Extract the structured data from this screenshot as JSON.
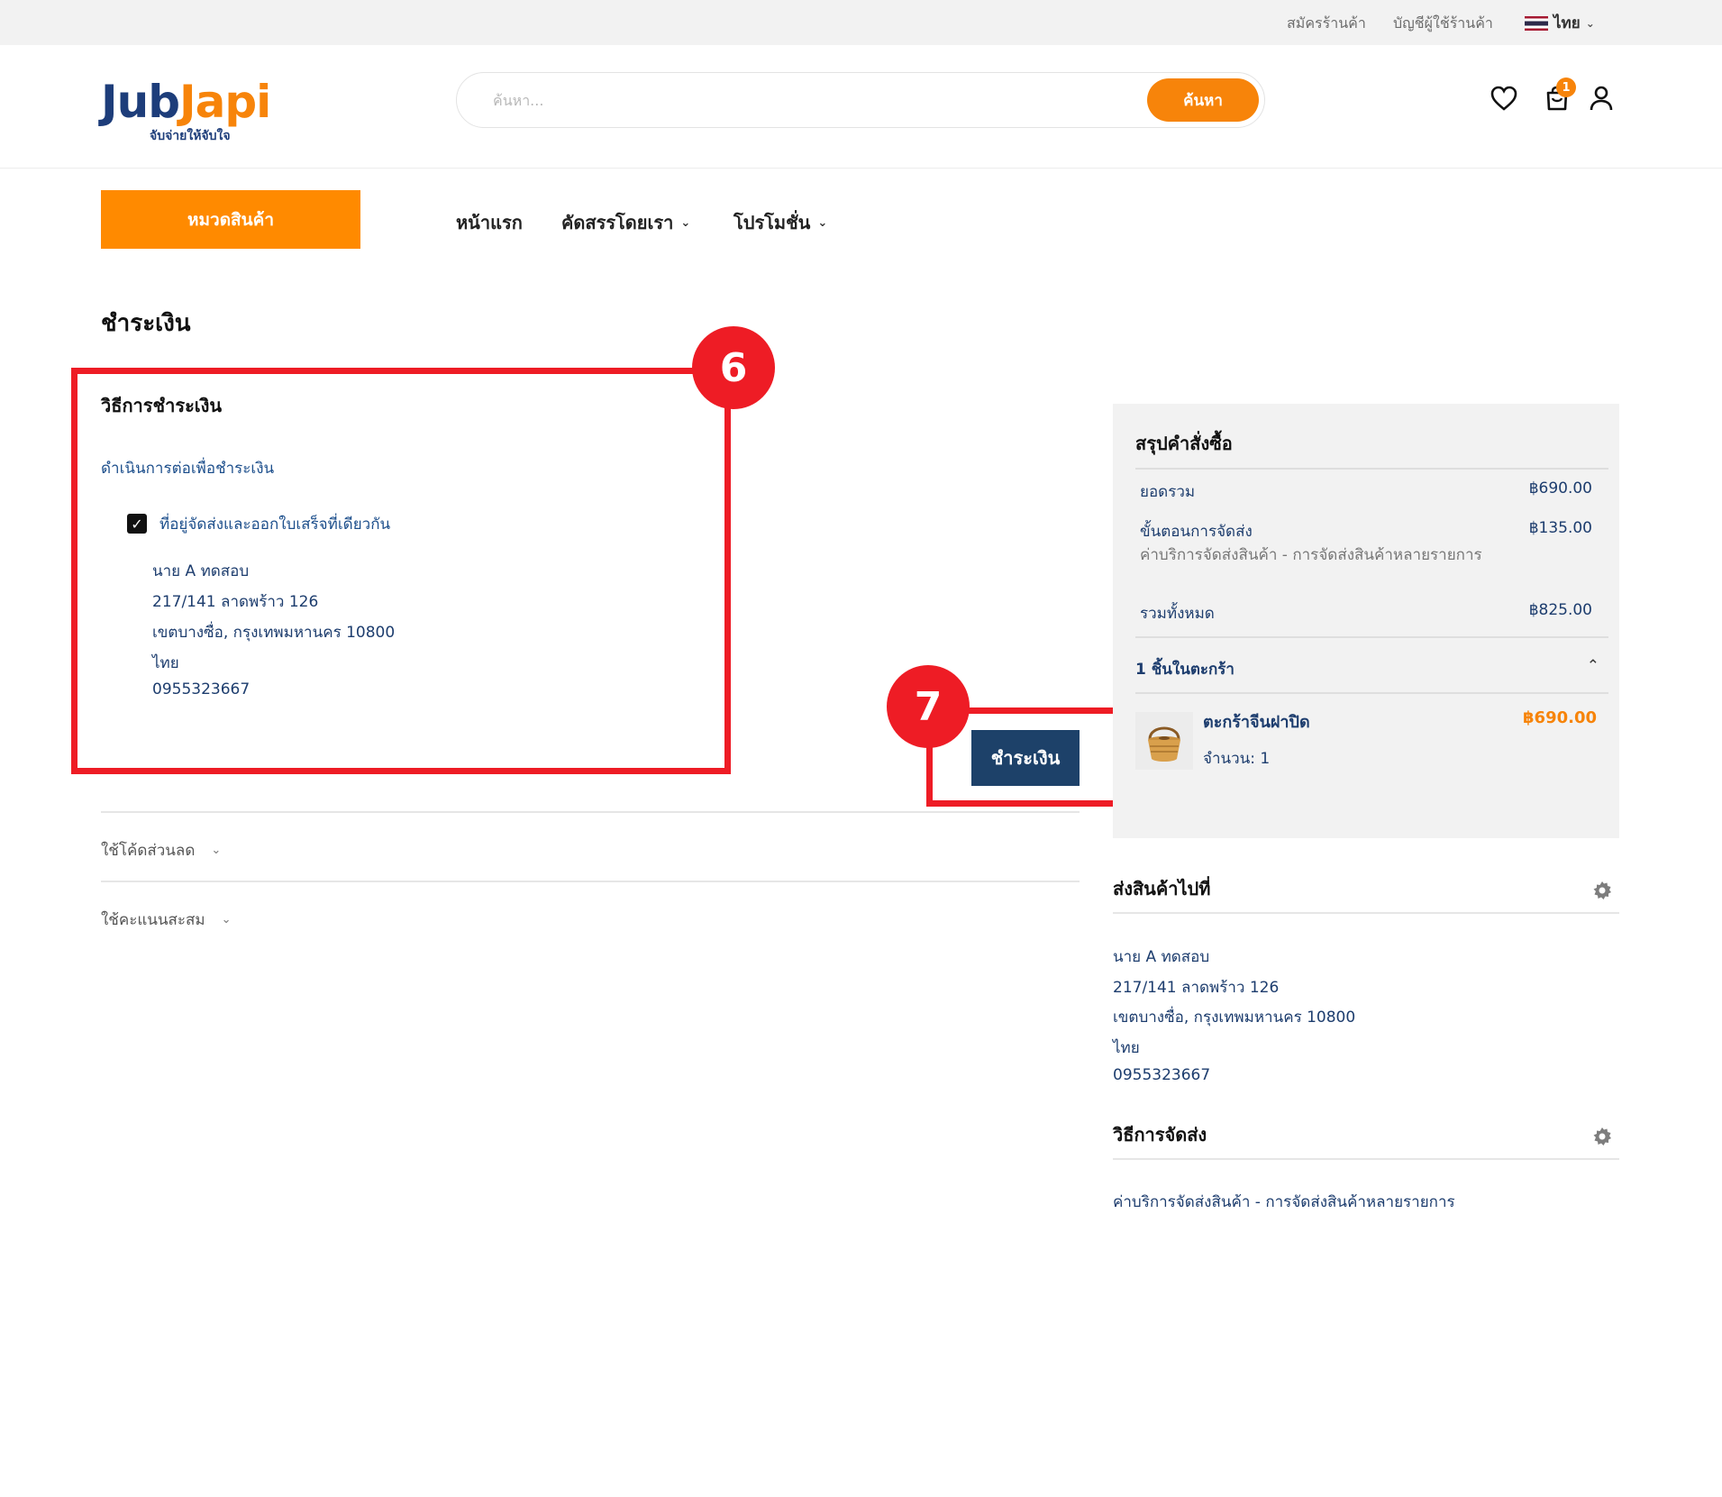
{
  "topbar": {
    "register_store": "สมัครร้านค้า",
    "store_account": "บัญชีผู้ใช้ร้านค้า",
    "language": "ไทย"
  },
  "header": {
    "logo_part1": "Jub",
    "logo_part2": "Japi",
    "logo_tagline": "จับจ่ายให้จับใจ",
    "search_placeholder": "ค้นหา...",
    "search_button": "ค้นหา",
    "cart_count": "1"
  },
  "nav": {
    "categories": "หมวดสินค้า",
    "home": "หน้าแรก",
    "curated": "คัดสรรโดยเรา",
    "promotions": "โปรโมชั่น"
  },
  "page_title": "ชำระเงิน",
  "payment": {
    "title": "วิธีการชำระเงิน",
    "proceed": "ดำเนินการต่อเพื่อชำระเงิน",
    "same_address_label": "ที่อยู่จัดส่งและออกใบเสร็จที่เดียวกัน",
    "address": [
      "นาย A ทดสอบ",
      "217/141 ลาดพร้าว 126",
      "เขตบางซื่อ, กรุงเทพมหานคร 10800",
      "ไทย",
      "0955323667"
    ],
    "pay_button": "ชำระเงิน"
  },
  "annotations": {
    "step6": "6",
    "step7": "7"
  },
  "discounts": {
    "coupon": "ใช้โค้ดส่วนลด",
    "points": "ใช้คะแนนสะสม"
  },
  "summary": {
    "title": "สรุปคำสั่งซื้อ",
    "subtotal_label": "ยอดรวม",
    "subtotal_value": "฿690.00",
    "shipping_label": "ขั้นตอนการจัดส่ง",
    "shipping_value": "฿135.00",
    "shipping_desc": "ค่าบริการจัดส่งสินค้า - การจัดส่งสินค้าหลายรายการ",
    "total_label": "รวมทั้งหมด",
    "total_value": "฿825.00",
    "cart_count_label": "1 ชิ้นในตะกร้า",
    "item_name": "ตะกร้าจีนฝาปิด",
    "item_price": "฿690.00",
    "item_qty": "จำนวน: 1"
  },
  "ship_to": {
    "title": "ส่งสินค้าไปที่",
    "address": [
      "นาย A ทดสอบ",
      "217/141 ลาดพร้าว 126",
      "เขตบางซื่อ, กรุงเทพมหานคร 10800",
      "ไทย",
      "0955323667"
    ]
  },
  "ship_method": {
    "title": "วิธีการจัดส่ง",
    "value": "ค่าบริการจัดส่งสินค้า - การจัดส่งสินค้าหลายรายการ"
  },
  "colors": {
    "brand_orange": "#f7840a",
    "brand_navy": "#1d4169",
    "annotation_red": "#ee1c25"
  },
  "icons": [
    "heart-icon",
    "cart-icon",
    "user-icon",
    "gear-icon",
    "check-icon",
    "chevron-down-icon",
    "chevron-up-icon"
  ]
}
